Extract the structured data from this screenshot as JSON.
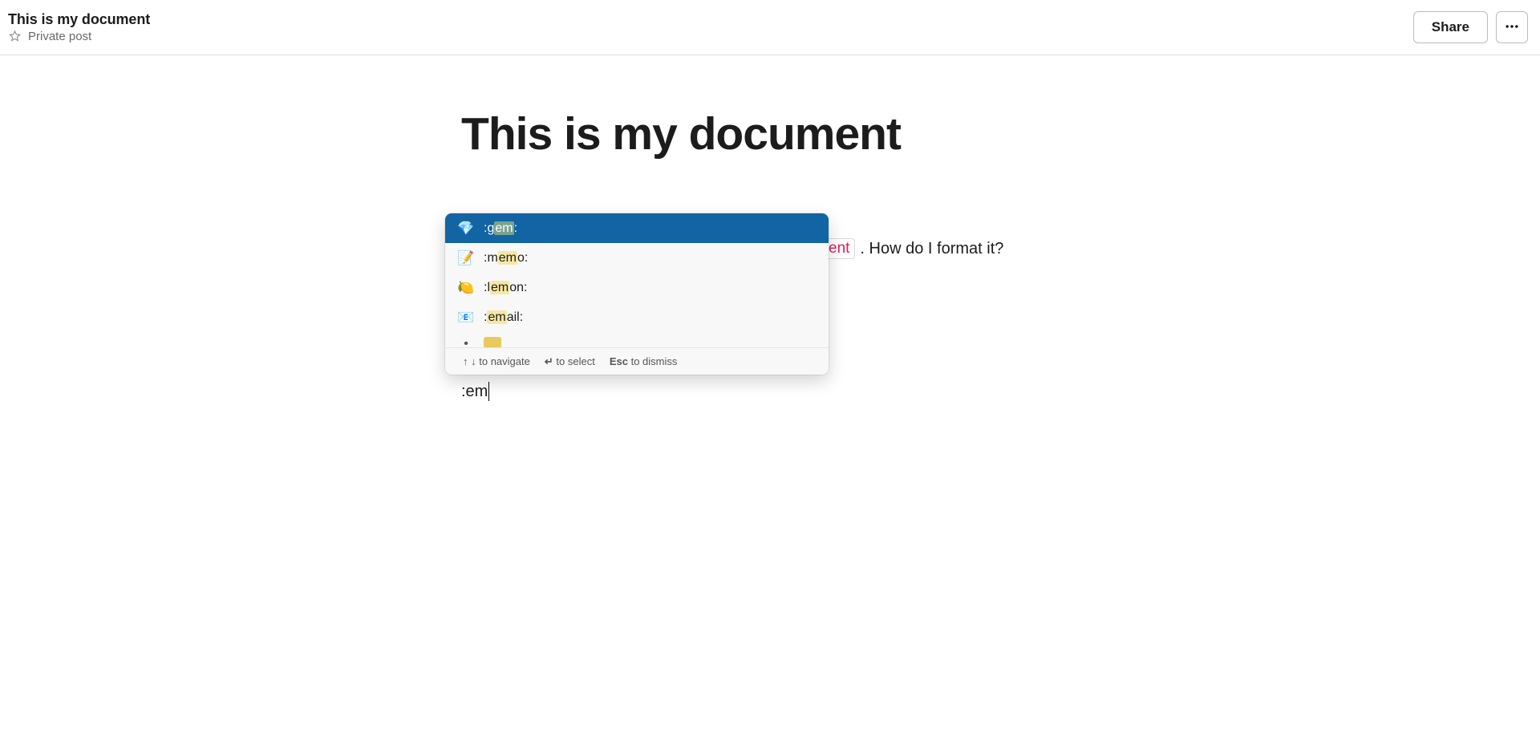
{
  "header": {
    "doc_title": "This is my document",
    "privacy_label": "Private post",
    "share_label": "Share"
  },
  "editor": {
    "h1": "This is my document",
    "para_token_tail": "ent",
    "para_after_token": ". How do I format it?",
    "input_text": ":em"
  },
  "suggest": {
    "options": [
      {
        "pre": ":g",
        "match": "em",
        "post": ":"
      },
      {
        "pre": ":m",
        "match": "em",
        "post": "o:"
      },
      {
        "pre": ":l",
        "match": "em",
        "post": "on:"
      },
      {
        "pre": ":",
        "match": "em",
        "post": "ail:"
      }
    ],
    "footer": {
      "nav_keys": "↑ ↓",
      "nav_label": "to navigate",
      "select_key": "↵",
      "select_label": "to select",
      "dismiss_key": "Esc",
      "dismiss_label": "to dismiss"
    }
  }
}
